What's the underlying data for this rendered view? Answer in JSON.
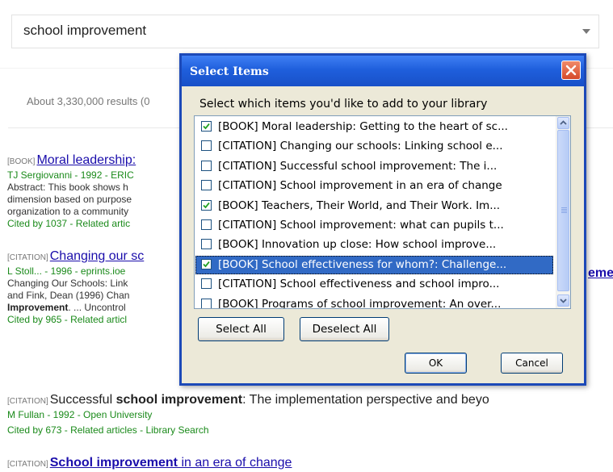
{
  "search": {
    "query": "school improvement"
  },
  "results_count": "About 3,330,000 results (0",
  "results": [
    {
      "tag": "[BOOK]",
      "title": "Moral leadership:",
      "author": "TJ Sergiovanni - 1992 - ERIC",
      "snippet": [
        "Abstract: This book shows h",
        "dimension based on purpose",
        "organization to a community"
      ],
      "cited": "Cited by 1037",
      "related": "Related artic"
    },
    {
      "tag": "[CITATION]",
      "title": "Changing our sc",
      "title_tail": "eme",
      "author": "L Stoll... - 1996 - eprints.ioe",
      "snippet": [
        "Changing Our Schools: Link",
        "and Fink, Dean (1996) Chan"
      ],
      "snippet_bold": "Improvement",
      "snippet_bold_tail": ". ... Uncontrol",
      "cited": "Cited by 965",
      "related": "Related articl"
    },
    {
      "tag": "[CITATION]",
      "title_pre": "Successful",
      "title_bold": "school improvement",
      "title_post": ": The implementation perspective and beyo",
      "author": "M Fullan - 1992 - Open University",
      "cited": "Cited by 673",
      "related": "Related articles",
      "library": "Library Search"
    },
    {
      "tag": "[CITATION]",
      "title_bold": "School improvement",
      "title_post": " in an era of change"
    }
  ],
  "dialog": {
    "title": "Select Items",
    "prompt": "Select which items you'd like to add to your library",
    "items": [
      {
        "label": "[BOOK] Moral leadership: Getting to the heart of sc...",
        "checked": true,
        "selected": false
      },
      {
        "label": "[CITATION] Changing our schools: Linking school e...",
        "checked": false,
        "selected": false
      },
      {
        "label": "[CITATION] Successful school improvement: The i...",
        "checked": false,
        "selected": false
      },
      {
        "label": "[CITATION] School improvement in an era of change",
        "checked": false,
        "selected": false
      },
      {
        "label": "[BOOK] Teachers, Their World, and Their Work. Im...",
        "checked": true,
        "selected": false
      },
      {
        "label": "[CITATION] School improvement: what can pupils t...",
        "checked": false,
        "selected": false
      },
      {
        "label": "[BOOK] Innovation up close: How school improve...",
        "checked": false,
        "selected": false
      },
      {
        "label": "[BOOK] School effectiveness for whom?: Challenge...",
        "checked": true,
        "selected": true
      },
      {
        "label": "[CITATION] School effectiveness and school impro...",
        "checked": false,
        "selected": false
      },
      {
        "label": "[BOOK] Programs of school improvement: An over...",
        "checked": false,
        "selected": false
      }
    ],
    "select_all": "Select All",
    "deselect_all": "Deselect All",
    "ok": "OK",
    "cancel": "Cancel"
  },
  "colors": {
    "link": "#1a0dab",
    "green": "#1a8a1a",
    "titlebar": "#1f5fdc",
    "selection": "#316ac5"
  }
}
